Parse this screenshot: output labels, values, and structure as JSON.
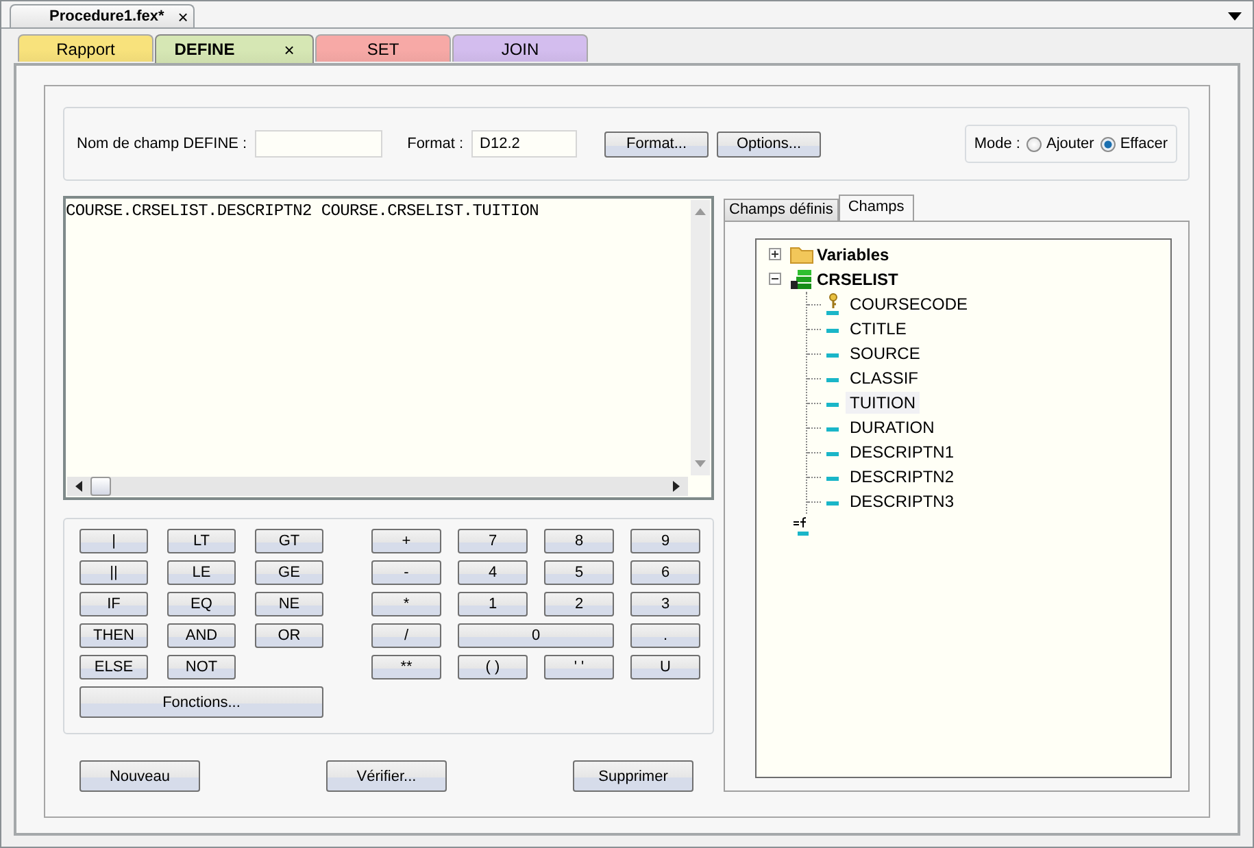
{
  "document_tab": {
    "title": "Procedure1.fex*",
    "close": "×"
  },
  "tabs": [
    {
      "label": "Rapport",
      "selected": false,
      "color": "#f8e27c",
      "closable": false
    },
    {
      "label": "DEFINE",
      "selected": true,
      "color": "#d6e7b4",
      "closable": true
    },
    {
      "label": "SET",
      "selected": false,
      "color": "#f7a9a6",
      "closable": false
    },
    {
      "label": "JOIN",
      "selected": false,
      "color": "#d3bdee",
      "closable": false
    }
  ],
  "define_close": "×",
  "field_row": {
    "name_label": "Nom de champ DEFINE :",
    "format_label": "Format :",
    "format_value": "D12.2",
    "buttons": [
      "Format...",
      "Options..."
    ],
    "mode_label": "Mode :",
    "modes": [
      {
        "label": "Ajouter",
        "selected": false
      },
      {
        "label": "Effacer",
        "selected": true
      }
    ]
  },
  "expression": "COURSE.CRSELIST.DESCRIPTN2 COURSE.CRSELIST.TUITION",
  "operator_keys": [
    {
      "label": "|",
      "kind": "key"
    },
    {
      "label": "LT",
      "kind": "key"
    },
    {
      "label": "GT",
      "kind": "key"
    },
    {
      "label": "||",
      "kind": "key"
    },
    {
      "label": "LE",
      "kind": "key"
    },
    {
      "label": "GE",
      "kind": "key"
    },
    {
      "label": "IF",
      "kind": "key"
    },
    {
      "label": "EQ",
      "kind": "key"
    },
    {
      "label": "NE",
      "kind": "key"
    },
    {
      "label": "THEN",
      "kind": "key"
    },
    {
      "label": "AND",
      "kind": "key"
    },
    {
      "label": "OR",
      "kind": "key"
    },
    {
      "label": "ELSE",
      "kind": "key"
    },
    {
      "label": "NOT",
      "kind": "key"
    },
    {
      "label": "Fonctions...",
      "kind": "full"
    }
  ],
  "number_keys": [
    {
      "label": "+",
      "kind": "key"
    },
    {
      "label": "7",
      "kind": "key"
    },
    {
      "label": "8",
      "kind": "key"
    },
    {
      "label": "9",
      "kind": "key"
    },
    {
      "label": "-",
      "kind": "key"
    },
    {
      "label": "4",
      "kind": "key"
    },
    {
      "label": "5",
      "kind": "key"
    },
    {
      "label": "6",
      "kind": "key"
    },
    {
      "label": "*",
      "kind": "key"
    },
    {
      "label": "1",
      "kind": "key"
    },
    {
      "label": "2",
      "kind": "key"
    },
    {
      "label": "3",
      "kind": "key"
    },
    {
      "label": "/",
      "kind": "key"
    },
    {
      "label": "0",
      "kind": "wide"
    },
    {
      "label": ".",
      "kind": "key"
    },
    {
      "label": "**",
      "kind": "key"
    },
    {
      "label": "( )",
      "kind": "key"
    },
    {
      "label": "' '",
      "kind": "key"
    },
    {
      "label": "U",
      "kind": "key"
    }
  ],
  "bottom_buttons": [
    "Nouveau",
    "Vérifier...",
    "Supprimer"
  ],
  "side_tabs": [
    {
      "label": "Champs définis",
      "selected": false
    },
    {
      "label": "Champs",
      "selected": true
    }
  ],
  "tree": [
    {
      "label": "Variables",
      "kind": "folder",
      "expanded": false
    },
    {
      "label": "CRSELIST",
      "kind": "table",
      "expanded": true,
      "children": [
        {
          "label": "COURSECODE",
          "kind": "key",
          "selected": false
        },
        {
          "label": "CTITLE",
          "kind": "field",
          "selected": false
        },
        {
          "label": "SOURCE",
          "kind": "field",
          "selected": false
        },
        {
          "label": "CLASSIF",
          "kind": "field",
          "selected": false
        },
        {
          "label": "TUITION",
          "kind": "field",
          "selected": true
        },
        {
          "label": "DURATION",
          "kind": "field",
          "selected": false
        },
        {
          "label": "DESCRIPTN1",
          "kind": "field",
          "selected": false
        },
        {
          "label": "DESCRIPTN2",
          "kind": "field",
          "selected": false
        },
        {
          "label": "DESCRIPTN3",
          "kind": "field",
          "selected": false
        }
      ]
    },
    {
      "kind": "formula"
    }
  ]
}
